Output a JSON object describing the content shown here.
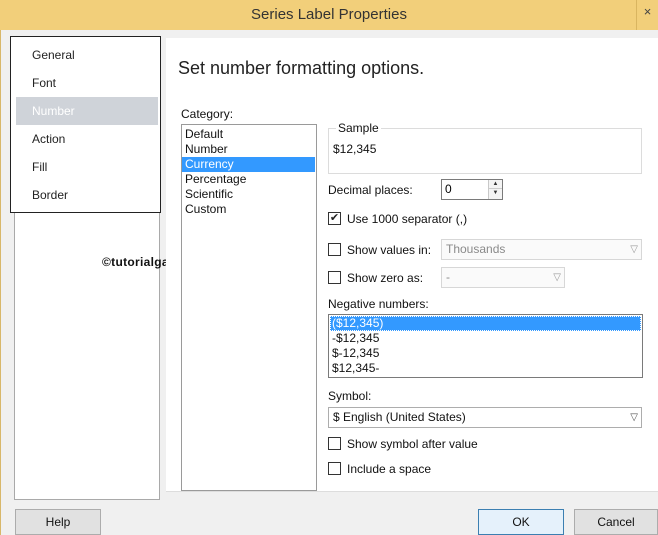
{
  "window": {
    "title": "Series Label Properties",
    "close_glyph": "×"
  },
  "nav": {
    "items": [
      {
        "label": "General",
        "selected": false
      },
      {
        "label": "Font",
        "selected": false
      },
      {
        "label": "Number",
        "selected": true
      },
      {
        "label": "Action",
        "selected": false
      },
      {
        "label": "Fill",
        "selected": false
      },
      {
        "label": "Border",
        "selected": false
      }
    ]
  },
  "watermark": "©tutorialgateway.org",
  "main": {
    "heading": "Set number formatting options.",
    "category_label": "Category:",
    "categories": [
      {
        "label": "Default",
        "selected": false
      },
      {
        "label": "Number",
        "selected": false
      },
      {
        "label": "Currency",
        "selected": true
      },
      {
        "label": "Percentage",
        "selected": false
      },
      {
        "label": "Scientific",
        "selected": false
      },
      {
        "label": "Custom",
        "selected": false
      }
    ],
    "sample": {
      "title": "Sample",
      "value": "$12,345"
    },
    "decimal_places": {
      "label": "Decimal places:",
      "value": "0"
    },
    "use_separator": {
      "label": "Use 1000 separator (,)",
      "checked": true
    },
    "show_values_in": {
      "label": "Show values in:",
      "checked": false,
      "value": "Thousands"
    },
    "show_zero_as": {
      "label": "Show zero as:",
      "checked": false,
      "value": "-"
    },
    "negative_numbers": {
      "label": "Negative numbers:",
      "options": [
        {
          "label": "($12,345)",
          "selected": true
        },
        {
          "label": "-$12,345",
          "selected": false
        },
        {
          "label": "$-12,345",
          "selected": false
        },
        {
          "label": "$12,345-",
          "selected": false
        }
      ]
    },
    "symbol": {
      "label": "Symbol:",
      "value": "$ English (United States)"
    },
    "symbol_after": {
      "label": "Show symbol after value",
      "checked": false
    },
    "include_space": {
      "label": "Include a space",
      "checked": false
    }
  },
  "buttons": {
    "help": "Help",
    "ok": "OK",
    "cancel": "Cancel"
  },
  "colors": {
    "title_bar": "#f2cf7a",
    "selection": "#3399ff",
    "nav_selection": "#cfd3d9"
  }
}
